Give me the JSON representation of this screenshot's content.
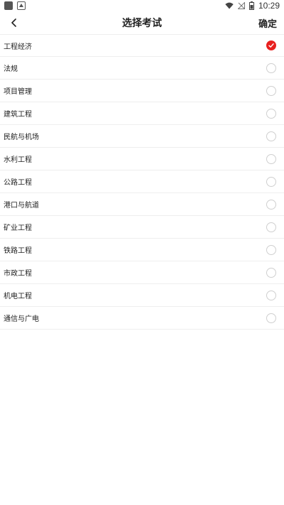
{
  "status_bar": {
    "time": "10:29"
  },
  "header": {
    "title": "选择考试",
    "confirm_label": "确定"
  },
  "colors": {
    "accent": "#e8201f",
    "divider": "#eeeeee",
    "radio_border": "#cfcfcf"
  },
  "exams": [
    {
      "label": "工程经济",
      "selected": true
    },
    {
      "label": "法规",
      "selected": false
    },
    {
      "label": "项目管理",
      "selected": false
    },
    {
      "label": "建筑工程",
      "selected": false
    },
    {
      "label": "民航与机场",
      "selected": false
    },
    {
      "label": "水利工程",
      "selected": false
    },
    {
      "label": "公路工程",
      "selected": false
    },
    {
      "label": "港口与航道",
      "selected": false
    },
    {
      "label": "矿业工程",
      "selected": false
    },
    {
      "label": "铁路工程",
      "selected": false
    },
    {
      "label": "市政工程",
      "selected": false
    },
    {
      "label": "机电工程",
      "selected": false
    },
    {
      "label": "通信与广电",
      "selected": false
    }
  ]
}
